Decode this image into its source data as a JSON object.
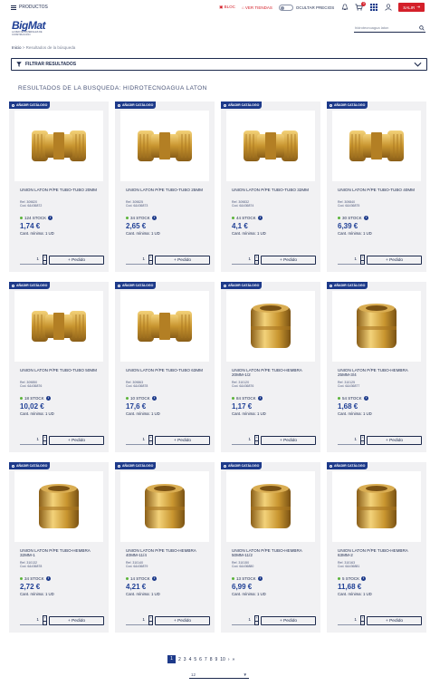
{
  "topbar": {
    "menu_label": "PRODUCTOS",
    "bloc_label": "BLOC",
    "stores_label": "VER TIENDAS",
    "hide_prices_label": "OCULTAR PRECIOS",
    "cart_count": "0",
    "logout_label": "SALIR"
  },
  "logo": {
    "name": "BigMat",
    "tagline": "LA RED DE MATERIALES DE CONSTRUCCIÓN"
  },
  "search": {
    "value": "hidrotecnoagua laton"
  },
  "breadcrumb": {
    "home": "Inicio",
    "separator": " > ",
    "current": "Resultados de la búsqueda"
  },
  "filter": {
    "label": "FILTRAR RESULTADOS"
  },
  "results_title": "RESULTADOS DE LA BUSQUEDA: HIDROTECNOAGUA LATON",
  "card_labels": {
    "tag": "AÑADIR CATÁLOGO",
    "order": "+ Pedido",
    "min_order": "Cant. mínima: 1 UD",
    "qty": "1",
    "info": "i"
  },
  "colors": {
    "brand_blue": "#1d3a8a",
    "accent_red": "#d4202a",
    "stock_green": "#5bb43a"
  },
  "products": [
    {
      "name": "UNION LATON P/PE TUBO-TUBO 20MM",
      "ref": "Ref. 309820",
      "cod": "Cod. 6&436872",
      "stock": "124 STOCK",
      "price": "1,74 €"
    },
    {
      "name": "UNION LATON P/PE TUBO-TUBO 25MM",
      "ref": "Ref. 309825",
      "cod": "Cod. 6&436873",
      "stock": "34 STOCK",
      "price": "2,65 €"
    },
    {
      "name": "UNION LATON P/PE TUBO-TUBO 32MM",
      "ref": "Ref. 309832",
      "cod": "Cod. 6&436874",
      "stock": "44 STOCK",
      "price": "4,1 €"
    },
    {
      "name": "UNION LATON P/PE TUBO-TUBO 40MM",
      "ref": "Ref. 309840",
      "cod": "Cod. 6&436875",
      "stock": "30 STOCK",
      "price": "6,39 €"
    },
    {
      "name": "UNION LATON P/PE TUBO-TUBO 50MM",
      "ref": "Ref. 309850",
      "cod": "Cod. 6&436876",
      "stock": "18 STOCK",
      "price": "10,02 €"
    },
    {
      "name": "UNION LATON P/PE TUBO-TUBO 63MM",
      "ref": "Ref. 309863",
      "cod": "Cod. 6&436878",
      "stock": "10 STOCK",
      "price": "17,6 €"
    },
    {
      "name": "UNION LATON P/PE TUBO-HEMBRA 20MM-1/2",
      "ref": "Ref. 310120",
      "cod": "Cod. 6&436876",
      "stock": "84 STOCK",
      "price": "1,17 €"
    },
    {
      "name": "UNION LATON P/PE TUBO-HEMBRA 25MM-3/4",
      "ref": "Ref. 310125",
      "cod": "Cod. 6&436877",
      "stock": "54 STOCK",
      "price": "1,68 €"
    },
    {
      "name": "UNION LATON P/PE TUBO-HEMBRA 32MM-1",
      "ref": "Ref. 310132",
      "cod": "Cod. 6&436878",
      "stock": "34 STOCK",
      "price": "2,72 €"
    },
    {
      "name": "UNION LATON P/PE TUBO-HEMBRA 40MM-11/4",
      "ref": "Ref. 310140",
      "cod": "Cod. 6&436879",
      "stock": "14 STOCK",
      "price": "4,21 €"
    },
    {
      "name": "UNION LATON P/PE TUBO-HEMBRA 50MM-11/2",
      "ref": "Ref. 310150",
      "cod": "Cod. 6&436880",
      "stock": "13 STOCK",
      "price": "6,99 €"
    },
    {
      "name": "UNION LATON P/PE TUBO-HEMBRA 63MM-2",
      "ref": "Ref. 310163",
      "cod": "Cod. 6&436881",
      "stock": "5 STOCK",
      "price": "11,68 €"
    }
  ],
  "pagination": {
    "pages": [
      "1",
      "2",
      "3",
      "4",
      "5",
      "6",
      "7",
      "8",
      "9",
      "10"
    ],
    "current": "1",
    "next": "›",
    "last": "»"
  },
  "per_page": {
    "value": "12"
  }
}
